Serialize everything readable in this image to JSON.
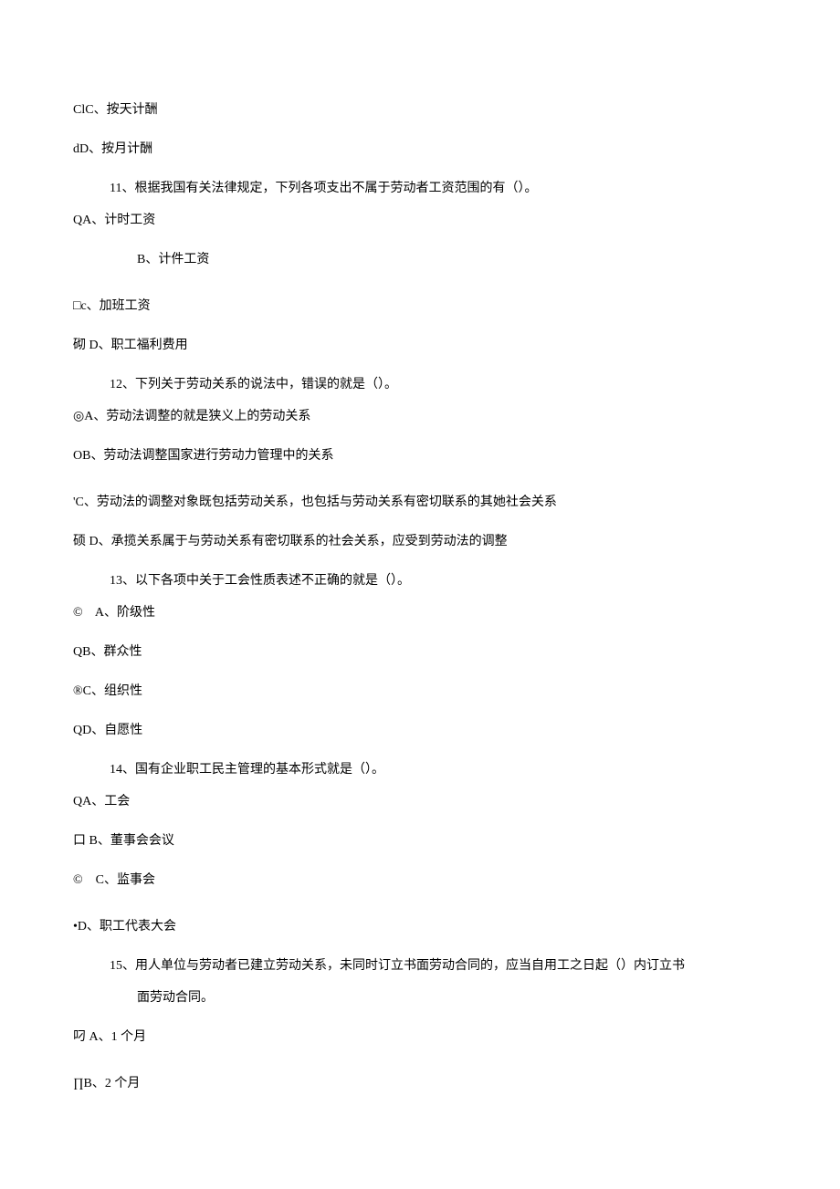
{
  "lines": [
    {
      "cls": "line",
      "text": "ClC、按天计酬"
    },
    {
      "cls": "line",
      "text": "dD、按月计酬"
    },
    {
      "cls": "line indent1 tight",
      "text": "11、根据我国有关法律规定，下列各项支出不属于劳动者工资范围的有（）。"
    },
    {
      "cls": "line",
      "text": "QA、计时工资"
    },
    {
      "cls": "line indent2",
      "text": "B、计件工资"
    },
    {
      "cls": "line gap-before",
      "text": "□c、加班工资"
    },
    {
      "cls": "line",
      "text": "砌 D、职工福利费用"
    },
    {
      "cls": "line indent1 tight",
      "text": "12、下列关于劳动关系的说法中，错误的就是（）。"
    },
    {
      "cls": "line",
      "text": "◎A、劳动法调整的就是狭义上的劳动关系"
    },
    {
      "cls": "line",
      "text": "OB、劳动法调整国家进行劳动力管理中的关系"
    },
    {
      "cls": "line gap-before",
      "text": "'C、劳动法的调整对象既包括劳动关系，也包括与劳动关系有密切联系的其她社会关系"
    },
    {
      "cls": "line",
      "text": "硕 D、承揽关系属于与劳动关系有密切联系的社会关系，应受到劳动法的调整"
    },
    {
      "cls": "line indent1 tight",
      "text": "13、以下各项中关于工会性质表述不正确的就是（）。"
    },
    {
      "cls": "line",
      "text": "©    A、阶级性"
    },
    {
      "cls": "line",
      "text": "QB、群众性"
    },
    {
      "cls": "line",
      "text": "®C、组织性"
    },
    {
      "cls": "line",
      "text": "QD、自愿性"
    },
    {
      "cls": "line indent1 tight",
      "text": "14、国有企业职工民主管理的基本形式就是（）。"
    },
    {
      "cls": "line",
      "text": "QA、工会"
    },
    {
      "cls": "line",
      "text": "口 B、董事会会议"
    },
    {
      "cls": "line",
      "text": "©    C、监事会"
    },
    {
      "cls": "line gap-before",
      "text": "•D、职工代表大会"
    },
    {
      "cls": "line indent1 tight",
      "text": "15、用人单位与劳动者已建立劳动关系，未同时订立书面劳动合同的，应当自用工之日起（）内订立书"
    },
    {
      "cls": "line indent2",
      "text": "面劳动合同。"
    },
    {
      "cls": "line",
      "text": "叼 A、1 个月"
    },
    {
      "cls": "line gap-before",
      "text": "∏B、2 个月"
    }
  ]
}
